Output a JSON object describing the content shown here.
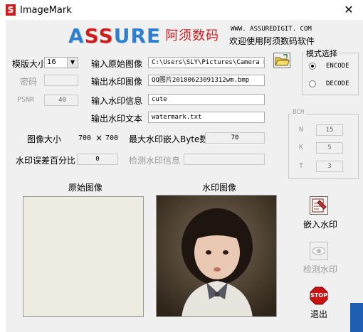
{
  "window": {
    "title": "ImageMark",
    "close_glyph": "✕"
  },
  "header": {
    "logo_text": "ASSURE阿须数码",
    "url": "WWW. ASSUREDIGIT. COM",
    "welcome": "欢迎使用阿须数码软件"
  },
  "params": {
    "template_size_label": "模版大小",
    "template_size_value": "16",
    "password_label": "密码",
    "password_value": "",
    "psnr_label": "PSNR",
    "psnr_value": "40"
  },
  "inputs": {
    "original_image_label": "输入原始图像",
    "original_image_value": "C:\\Users\\SLY\\Pictures\\Camera Ro",
    "output_image_label": "输出水印图像",
    "output_image_value": "QQ图片20180623091312wm.bmp",
    "watermark_info_label": "输入水印信息",
    "watermark_info_value": "cute",
    "watermark_text_label": "输出水印文本",
    "watermark_text_value": "watermark.txt"
  },
  "stats": {
    "image_size_label": "图像大小",
    "image_width": "700",
    "times": "×",
    "image_height": "700",
    "max_embed_label": "最大水印嵌入Byte数",
    "max_embed_value": "70",
    "error_pct_label": "水印误差百分比",
    "error_pct_value": "0",
    "detect_info_label": "检测水印信息",
    "detect_info_value": ""
  },
  "mode": {
    "title": "模式选择",
    "options": [
      {
        "label": "ENCODE",
        "checked": true
      },
      {
        "label": "DECODE",
        "checked": false
      }
    ]
  },
  "bch": {
    "title": "BCH",
    "n_label": "N",
    "n_value": "15",
    "k_label": "K",
    "k_value": "5",
    "t_label": "T",
    "t_value": "3"
  },
  "panels": {
    "original_label": "原始图像",
    "watermark_label": "水印图像"
  },
  "actions": {
    "embed_label": "嵌入水印",
    "detect_label": "检测水印",
    "exit_label": "退出",
    "stop_text": "STOP"
  },
  "colors": {
    "logo_blue": "#2e7fd0",
    "logo_red": "#d21c1c",
    "stop_red": "#cc1111",
    "folder_yellow": "#e8c84a"
  }
}
